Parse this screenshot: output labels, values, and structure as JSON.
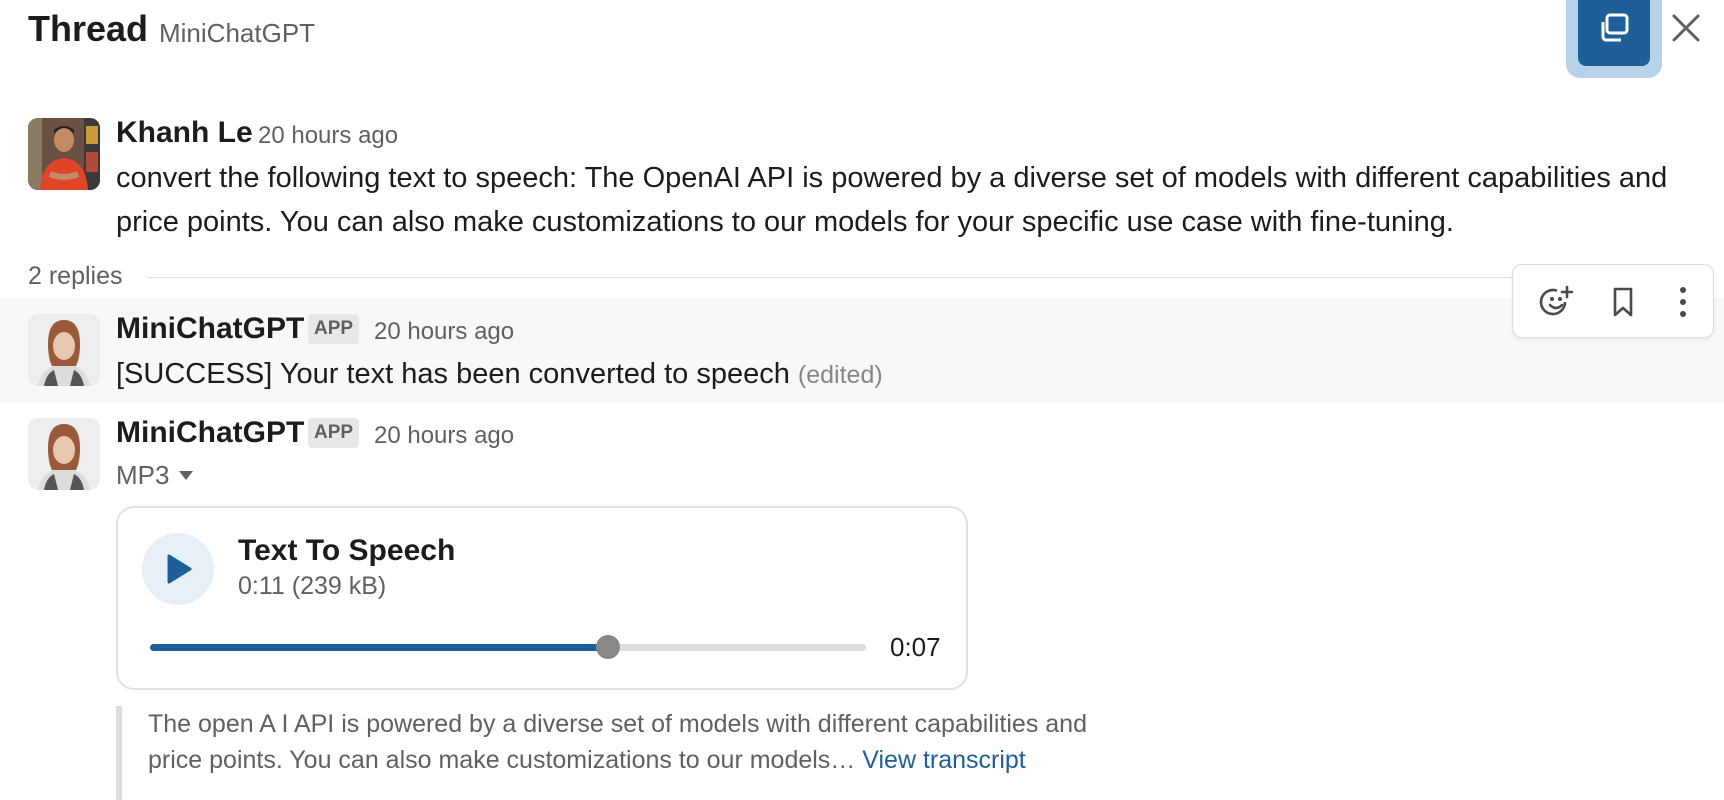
{
  "header": {
    "title": "Thread",
    "channel": "MiniChatGPT"
  },
  "parent": {
    "author": "Khanh Le",
    "time": "20 hours ago",
    "text_line1": "convert the following text to speech: The OpenAI API is powered by a diverse set of models with different capabilities and",
    "text_line2": "price points. You can also make customizations to our models for your specific use case with fine-tuning."
  },
  "replies": {
    "label": "2 replies"
  },
  "reply1": {
    "author": "MiniChatGPT",
    "badge": "APP",
    "time": "20 hours ago",
    "text": "[SUCCESS] Your text has been converted to speech",
    "edited": "(edited)"
  },
  "reply2": {
    "author": "MiniChatGPT",
    "badge": "APP",
    "time": "20 hours ago",
    "file_type": "MP3",
    "audio": {
      "title": "Text To Speech",
      "meta": "0:11 (239 kB)",
      "elapsed": "0:07",
      "progress": 0.64
    },
    "transcript": {
      "text": "The open A I API is powered by a diverse set of models with different capabilities and price points. You can also make customizations to our models…",
      "link": "View transcript"
    }
  },
  "icons": {
    "expand": "expand-window-icon",
    "close": "close-icon",
    "react": "add-reaction-icon",
    "save": "bookmark-icon",
    "more": "more-actions-icon",
    "play": "play-icon"
  },
  "colors": {
    "accent": "#1f5f99",
    "focus": "#b7d3ea",
    "muted": "#616061"
  }
}
